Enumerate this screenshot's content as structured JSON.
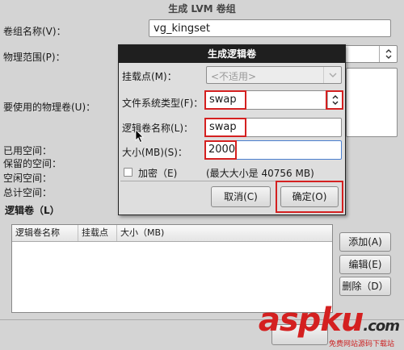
{
  "window": {
    "title": "生成 LVM 卷组"
  },
  "main": {
    "vg_name_label": "卷组名称(V)：",
    "vg_name_value": "vg_kingset",
    "extent_label": "物理范围(P)：",
    "pv_label": "要使用的物理卷(U)：",
    "used_label": "已用空间：",
    "reserved_label": "保留的空间：",
    "free_label": "空闲空间：",
    "total_label": "总计空间：",
    "lv_section_label": "逻辑卷（L）",
    "table_headers": [
      "逻辑卷名称",
      "挂载点",
      "大小（MB)"
    ],
    "add_button": "添加(A)",
    "edit_button": "编辑(E)",
    "delete_button": "删除（D）"
  },
  "dialog": {
    "title": "生成逻辑卷",
    "mount_label": "挂载点(M)：",
    "mount_value": "<不适用>",
    "fs_label": "文件系统类型(F)：",
    "fs_value": "swap",
    "lv_name_label": "逻辑卷名称(L)：",
    "lv_name_value": "swap",
    "size_label": "大小(MB)(S)：",
    "size_value": "2000",
    "encrypt_label": "加密（E)",
    "encrypt_checked": false,
    "max_size_text": "(最大大小是 40756 MB)",
    "cancel_button": "取消(C)",
    "ok_button": "确定(O)"
  },
  "watermark": {
    "brand": "aspku",
    "suffix": ".com",
    "tagline": "免费网站源码下载站"
  },
  "colors": {
    "highlight": "#d42020",
    "dialog_title_bg": "#1f1f1f",
    "focus_border": "#4a7fd0"
  },
  "icons": [
    "chevron-down-icon",
    "mouse-cursor-icon",
    "checkbox-icon"
  ]
}
